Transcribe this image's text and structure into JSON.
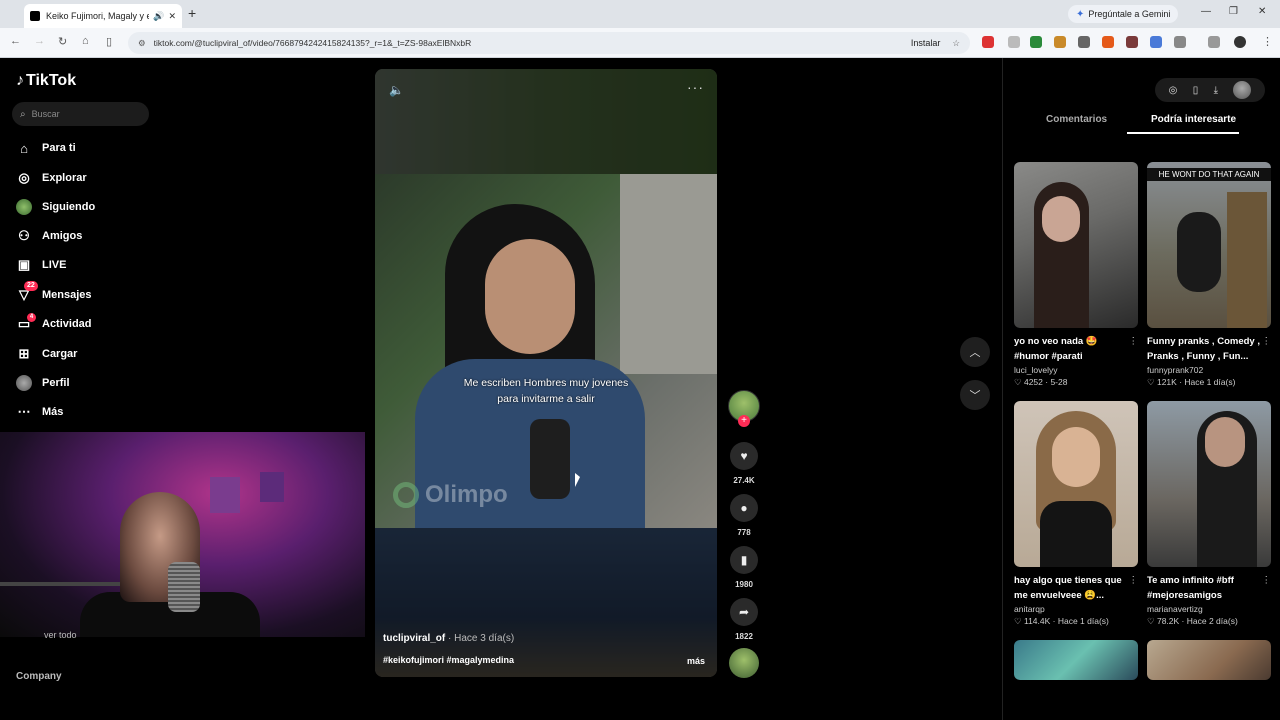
{
  "browser": {
    "tab_title": "Keiko Fujimori, Magaly y el",
    "new_tab": "+",
    "gemini_label": "Pregúntale a Gemini",
    "url": "tiktok.com/@tuclipviral_of/video/7668794242415824135?_r=1&_t=ZS-98axElBNxbR",
    "install_label": "Instalar"
  },
  "sidebar": {
    "logo": "TikTok",
    "search_placeholder": "Buscar",
    "items": [
      {
        "label": "Para ti",
        "icon": "home-icon"
      },
      {
        "label": "Explorar",
        "icon": "compass-icon"
      },
      {
        "label": "Siguiendo",
        "icon": "following-avatar-icon"
      },
      {
        "label": "Amigos",
        "icon": "friends-icon"
      },
      {
        "label": "LIVE",
        "icon": "live-icon"
      },
      {
        "label": "Mensajes",
        "icon": "messages-icon",
        "badge": "22"
      },
      {
        "label": "Actividad",
        "icon": "activity-icon",
        "badge": "4"
      },
      {
        "label": "Cargar",
        "icon": "upload-icon"
      },
      {
        "label": "Perfil",
        "icon": "profile-avatar-icon"
      },
      {
        "label": "Más",
        "icon": "more-icon"
      }
    ],
    "partial_text": "ver todo",
    "company": "Company"
  },
  "video": {
    "caption_line1": "Me escriben Hombres muy jovenes",
    "caption_line2": "para invitarme a salir",
    "watermark": "Olimpo",
    "author": "tuclipviral_of",
    "time": " · Hace 3 día(s)",
    "hashtags": "#keikofujimori #magalymedina",
    "more": "más"
  },
  "actions": {
    "likes": "27.4K",
    "comments": "778",
    "saves": "1980",
    "shares": "1822"
  },
  "right_panel": {
    "tab_comments": "Comentarios",
    "tab_interest": "Podría interesarte",
    "cards": [
      {
        "title": "yo no veo nada 🤩 #humor #parati",
        "user": "luci_lovelyy",
        "stats": "♡ 4252 · 5-28",
        "overlay": ""
      },
      {
        "title": "Funny pranks , Comedy , Pranks , Funny , Fun...",
        "user": "funnyprank702",
        "stats": "♡ 121K · Hace 1 día(s)",
        "overlay": "HE WONT DO THAT AGAIN"
      },
      {
        "title": "hay algo que tienes que me envuelveee 😩...",
        "user": "anitarqp",
        "stats": "♡ 114.4K · Hace 1 día(s)",
        "overlay": ""
      },
      {
        "title": "Te amo infinito #bff #mejoresamigos",
        "user": "marianavertizg",
        "stats": "♡ 78.2K · Hace 2 día(s)",
        "overlay": ""
      }
    ]
  }
}
